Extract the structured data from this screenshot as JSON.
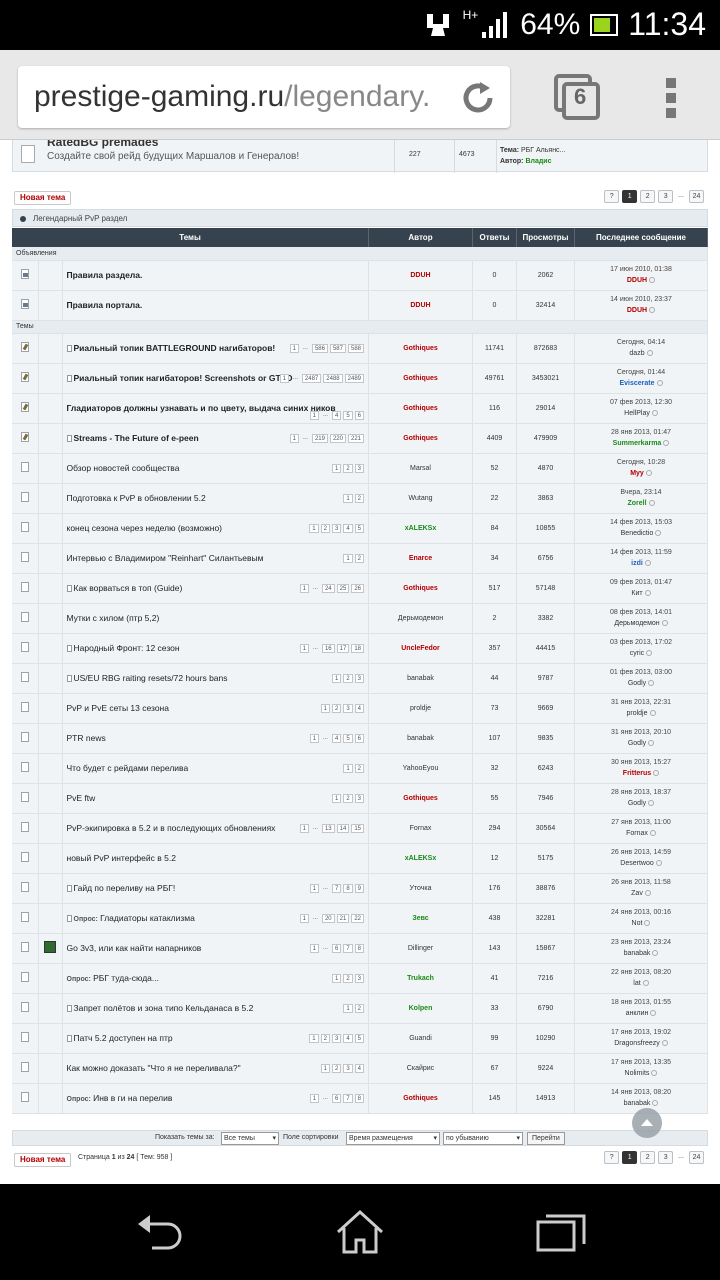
{
  "status": {
    "signal": "H+",
    "battery": "64%",
    "time": "11:34"
  },
  "browser": {
    "url_host": "prestige-gaming.ru",
    "url_path": "/legendary.",
    "tab_count": "6"
  },
  "top_forum": {
    "title": "RatedBG premades",
    "desc": "Создайте свой рейд будущих Маршалов и Генералов!",
    "topics": "227",
    "posts": "4673",
    "last_topic_label": "Тема:",
    "last_topic": "РБГ Альянс...",
    "last_author_label": "Автор:",
    "last_author": "Владис"
  },
  "new_topic_label": "Новая тема",
  "pagination": {
    "prev": "?",
    "pages": [
      "1",
      "2",
      "3"
    ],
    "dots": "...",
    "last": "24"
  },
  "forum_title": "Легендарный PvP раздел",
  "headers": {
    "topics": "Темы",
    "author": "Автор",
    "replies": "Ответы",
    "views": "Просмотры",
    "last": "Последнее сообщение"
  },
  "section_ann": "Объявления",
  "section_topics": "Темы",
  "announcements": [
    {
      "title": "Правила раздела.",
      "author": "DDUH",
      "acolor": "red",
      "replies": "0",
      "views": "2062",
      "date": "17 июн 2010, 01:38",
      "last": "DDUH",
      "lcolor": "red"
    },
    {
      "title": "Правила портала.",
      "author": "DDUH",
      "acolor": "red",
      "replies": "0",
      "views": "32414",
      "date": "14 июн 2010, 23:37",
      "last": "DDUH",
      "lcolor": "red"
    }
  ],
  "topics": [
    {
      "title": "Риальный топик BATTLEGROUND нагибаторов!",
      "att": true,
      "bold": true,
      "icon": "pen",
      "pages": [
        "1",
        "...",
        "586",
        "587",
        "588"
      ],
      "author": "Gothiques",
      "acolor": "red",
      "replies": "11741",
      "views": "872683",
      "date": "Сегодня, 04:14",
      "last": "dazb",
      "lcolor": "plain"
    },
    {
      "title": "Риальный топик нагибаторов! Screenshots or GTFO",
      "att": true,
      "bold": true,
      "icon": "pen",
      "pages": [
        "1",
        "...",
        "2487",
        "2488",
        "2489"
      ],
      "author": "Gothiques",
      "acolor": "red",
      "replies": "49761",
      "views": "3453021",
      "date": "Сегодня, 01:44",
      "last": "Eviscerate",
      "lcolor": "blue"
    },
    {
      "title": "Гладиаторов должны узнавать и по цвету, выдача синих ников",
      "att": false,
      "bold": true,
      "icon": "pen",
      "pages": [
        "1",
        "...",
        "4",
        "5",
        "6"
      ],
      "author": "Gothiques",
      "acolor": "red",
      "replies": "116",
      "views": "29014",
      "date": "07 фев 2013, 12:30",
      "last": "HellPlay",
      "lcolor": "plain"
    },
    {
      "title": "Streams - The Future of e-peen",
      "att": true,
      "bold": true,
      "icon": "pen",
      "pages": [
        "1",
        "...",
        "219",
        "220",
        "221"
      ],
      "author": "Gothiques",
      "acolor": "red",
      "replies": "4409",
      "views": "479909",
      "date": "28 янв 2013, 01:47",
      "last": "Summerkarma",
      "lcolor": "green"
    },
    {
      "title": "Обзор новостей сообщества",
      "att": false,
      "bold": false,
      "icon": "doc",
      "pages": [
        "1",
        "2",
        "3"
      ],
      "author": "Marsal",
      "acolor": "plain",
      "replies": "52",
      "views": "4870",
      "date": "Сегодня, 10:28",
      "last": "Myy",
      "lcolor": "red"
    },
    {
      "title": "Подготовка к PvP в обновлении 5.2",
      "att": false,
      "bold": false,
      "icon": "doc",
      "pages": [
        "1",
        "2"
      ],
      "author": "Wutang",
      "acolor": "plain",
      "replies": "22",
      "views": "3863",
      "date": "Вчера, 23:14",
      "last": "Zorell",
      "lcolor": "green"
    },
    {
      "title": "конец сезона через неделю (возможно)",
      "att": false,
      "bold": false,
      "icon": "doc",
      "pages": [
        "1",
        "2",
        "3",
        "4",
        "5"
      ],
      "author": "xALEKSx",
      "acolor": "green",
      "replies": "84",
      "views": "10855",
      "date": "14 фев 2013, 15:03",
      "last": "Benedictio",
      "lcolor": "plain"
    },
    {
      "title": "Интервью с Владимиром \"Reinhart\" Силантьевым",
      "att": false,
      "bold": false,
      "icon": "doc",
      "pages": [
        "1",
        "2"
      ],
      "author": "Enarce",
      "acolor": "red",
      "replies": "34",
      "views": "6756",
      "date": "14 фев 2013, 11:59",
      "last": "izdi",
      "lcolor": "blue"
    },
    {
      "title": "Как ворваться в топ (Guide)",
      "att": true,
      "bold": false,
      "icon": "doc",
      "pages": [
        "1",
        "...",
        "24",
        "25",
        "26"
      ],
      "author": "Gothiques",
      "acolor": "red",
      "replies": "517",
      "views": "57148",
      "date": "09 фев 2013, 01:47",
      "last": "Кит",
      "lcolor": "plain"
    },
    {
      "title": "Мутки с хилом (птр 5,2)",
      "att": false,
      "bold": false,
      "icon": "doc",
      "pages": [],
      "author": "Дерьмодемон",
      "acolor": "plain",
      "replies": "2",
      "views": "3382",
      "date": "08 фев 2013, 14:01",
      "last": "Дерьмодемон",
      "lcolor": "plain"
    },
    {
      "title": "Народный Фронт: 12 сезон",
      "att": true,
      "bold": false,
      "icon": "doc",
      "pages": [
        "1",
        "...",
        "16",
        "17",
        "18"
      ],
      "author": "UncleFedor",
      "acolor": "red",
      "replies": "357",
      "views": "44415",
      "date": "03 фев 2013, 17:02",
      "last": "cyric",
      "lcolor": "plain"
    },
    {
      "title": "US/EU RBG raiting resets/72 hours bans",
      "att": true,
      "bold": false,
      "icon": "doc",
      "pages": [
        "1",
        "2",
        "3"
      ],
      "author": "banabak",
      "acolor": "plain",
      "replies": "44",
      "views": "9787",
      "date": "01 фев 2013, 03:00",
      "last": "Godly",
      "lcolor": "plain"
    },
    {
      "title": "PvP и PvE сеты 13 сезона",
      "att": false,
      "bold": false,
      "icon": "doc",
      "pages": [
        "1",
        "2",
        "3",
        "4"
      ],
      "author": "proldje",
      "acolor": "plain",
      "replies": "73",
      "views": "9669",
      "date": "31 янв 2013, 22:31",
      "last": "proldje",
      "lcolor": "plain"
    },
    {
      "title": "PTR news",
      "att": false,
      "bold": false,
      "icon": "doc",
      "pages": [
        "1",
        "...",
        "4",
        "5",
        "6"
      ],
      "author": "banabak",
      "acolor": "plain",
      "replies": "107",
      "views": "9835",
      "date": "31 янв 2013, 20:10",
      "last": "Godly",
      "lcolor": "plain"
    },
    {
      "title": "Что будет с рейдами перелива",
      "att": false,
      "bold": false,
      "icon": "doc",
      "pages": [
        "1",
        "2"
      ],
      "author": "YahooEyou",
      "acolor": "plain",
      "replies": "32",
      "views": "6243",
      "date": "30 янв 2013, 15:27",
      "last": "Fritterus",
      "lcolor": "red"
    },
    {
      "title": "PvE ftw",
      "att": false,
      "bold": false,
      "icon": "doc",
      "pages": [
        "1",
        "2",
        "3"
      ],
      "author": "Gothiques",
      "acolor": "red",
      "replies": "55",
      "views": "7946",
      "date": "28 янв 2013, 18:37",
      "last": "Godly",
      "lcolor": "plain"
    },
    {
      "title": "PvP-экипировка в 5.2 и в последующих обновлениях",
      "att": false,
      "bold": false,
      "icon": "doc",
      "pages": [
        "1",
        "...",
        "13",
        "14",
        "15"
      ],
      "author": "Fornax",
      "acolor": "plain",
      "replies": "294",
      "views": "30564",
      "date": "27 янв 2013, 11:00",
      "last": "Fornax",
      "lcolor": "plain"
    },
    {
      "title": "новый PvP интерфейс в 5.2",
      "att": false,
      "bold": false,
      "icon": "doc",
      "pages": [],
      "author": "xALEKSx",
      "acolor": "green",
      "replies": "12",
      "views": "5175",
      "date": "26 янв 2013, 14:59",
      "last": "Desertwoo",
      "lcolor": "plain"
    },
    {
      "title": "Гайд по переливу на РБГ!",
      "att": true,
      "bold": false,
      "icon": "doc",
      "pages": [
        "1",
        "...",
        "7",
        "8",
        "9"
      ],
      "author": "Уточка",
      "acolor": "plain",
      "replies": "176",
      "views": "38876",
      "date": "26 янв 2013, 11:58",
      "last": "Zav",
      "lcolor": "plain"
    },
    {
      "title": "Гладиаторы катаклизма",
      "poll": "Опрос:",
      "att": true,
      "bold": false,
      "icon": "doc",
      "pages": [
        "1",
        "...",
        "20",
        "21",
        "22"
      ],
      "author": "Зевс",
      "acolor": "green",
      "replies": "438",
      "views": "32281",
      "date": "24 янв 2013, 00:16",
      "last": "Not",
      "lcolor": "plain"
    },
    {
      "title": "Go 3v3, или как найти напарников",
      "att": false,
      "bold": false,
      "icon": "doc",
      "img": true,
      "pages": [
        "1",
        "...",
        "6",
        "7",
        "8"
      ],
      "author": "Dillinger",
      "acolor": "plain",
      "replies": "143",
      "views": "15867",
      "date": "23 янв 2013, 23:24",
      "last": "banabak",
      "lcolor": "plain"
    },
    {
      "title": "РБГ туда-сюда...",
      "poll": "Опрос:",
      "att": false,
      "bold": false,
      "icon": "doc",
      "pages": [
        "1",
        "2",
        "3"
      ],
      "author": "Trukach",
      "acolor": "green",
      "replies": "41",
      "views": "7216",
      "date": "22 янв 2013, 08:20",
      "last": "lat",
      "lcolor": "plain"
    },
    {
      "title": "Запрет полётов и зона типо Кельданаса в 5.2",
      "att": true,
      "bold": false,
      "icon": "doc",
      "pages": [
        "1",
        "2"
      ],
      "author": "Kolpen",
      "acolor": "green",
      "replies": "33",
      "views": "6790",
      "date": "18 янв 2013, 01:55",
      "last": "анклин",
      "lcolor": "plain"
    },
    {
      "title": "Патч 5.2 доступен на птр",
      "att": true,
      "bold": false,
      "icon": "doc",
      "pages": [
        "1",
        "2",
        "3",
        "4",
        "5"
      ],
      "author": "Guandi",
      "acolor": "plain",
      "replies": "99",
      "views": "10290",
      "date": "17 янв 2013, 19:02",
      "last": "Dragonsfreezy",
      "lcolor": "plain"
    },
    {
      "title": "Как можно доказать \"Что я не переливала?\"",
      "att": false,
      "bold": false,
      "icon": "doc",
      "pages": [
        "1",
        "2",
        "3",
        "4"
      ],
      "author": "Скайрис",
      "acolor": "plain",
      "replies": "67",
      "views": "9224",
      "date": "17 янв 2013, 13:35",
      "last": "Nolimits",
      "lcolor": "plain"
    },
    {
      "title": "Инв в ги на перелив",
      "poll": "Опрос:",
      "att": false,
      "bold": false,
      "icon": "doc",
      "pages": [
        "1",
        "...",
        "6",
        "7",
        "8"
      ],
      "author": "Gothiques",
      "acolor": "red",
      "replies": "145",
      "views": "14913",
      "date": "14 янв 2013, 08:20",
      "last": "banabak",
      "lcolor": "plain"
    }
  ],
  "sort": {
    "show_label": "Показать темы за:",
    "show_value": "Все темы",
    "field_label": "Поле сортировки",
    "field_value": "Время размещения",
    "order_value": "по убыванию",
    "go": "Перейти"
  },
  "footer_info": {
    "page_label": "Страница",
    "page": "1",
    "of": "из",
    "total": "24",
    "topics": "Тем: 958"
  }
}
